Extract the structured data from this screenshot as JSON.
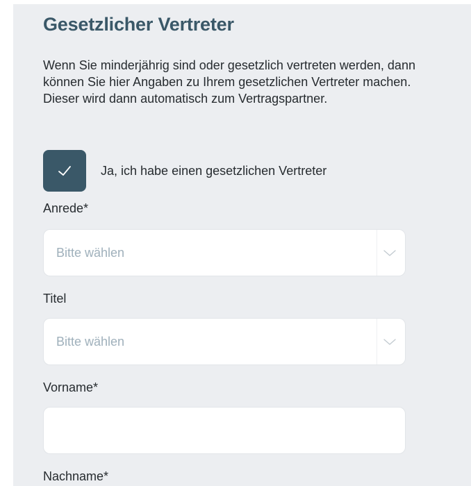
{
  "section": {
    "title": "Gesetzlicher Vertreter",
    "description": "Wenn Sie minderjährig sind oder gesetzlich vertreten werden, dann können Sie hier Angaben zu Ihrem gesetzlichen Vertreter machen. Dieser wird dann automatisch zum Vertragspartner."
  },
  "checkbox": {
    "label": "Ja, ich habe einen gesetzlichen Vertreter",
    "checked": true,
    "icon": "checkmark-icon"
  },
  "fields": {
    "anrede": {
      "label": "Anrede*",
      "placeholder": "Bitte wählen",
      "icon": "chevron-down-icon"
    },
    "titel": {
      "label": "Titel",
      "placeholder": "Bitte wählen",
      "icon": "chevron-down-icon"
    },
    "vorname": {
      "label": "Vorname*",
      "value": ""
    },
    "nachname": {
      "label": "Nachname*"
    }
  },
  "colors": {
    "accent": "#3a5868",
    "panel_background": "#eceef1",
    "placeholder": "#9fb0bb",
    "text": "#262b2f"
  }
}
